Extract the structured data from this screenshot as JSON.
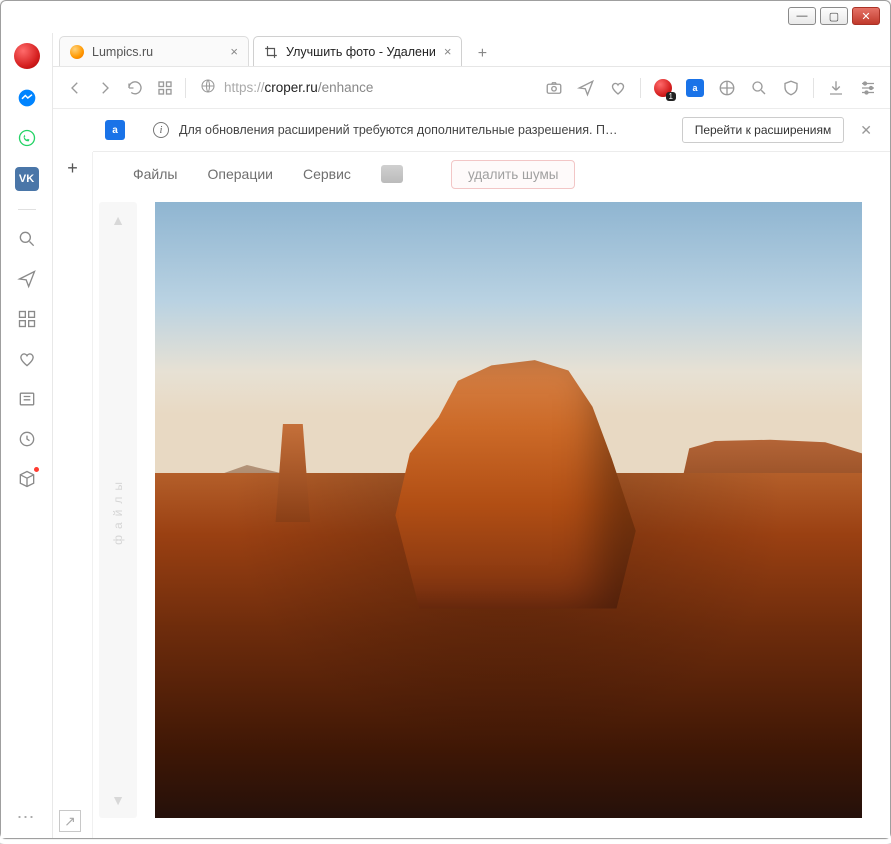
{
  "window": {
    "controls": {
      "minimize": "—",
      "maximize": "▢",
      "close": "✕"
    }
  },
  "tabs": [
    {
      "title": "Lumpics.ru",
      "active": false
    },
    {
      "title": "Улучшить фото - Удалени",
      "active": true
    }
  ],
  "newtab_label": "+",
  "addressbar": {
    "protocol": "https://",
    "host": "croper.ru",
    "path": "/enhance"
  },
  "nav_badge": "1",
  "ext_notice": {
    "icon_letter": "a",
    "message": "Для обновления расширений требуются дополнительные разрешения. Перейдите в ме…",
    "button": "Перейти к расширениям",
    "close": "✕"
  },
  "inner_left": {
    "plus": "+"
  },
  "app_menu": {
    "files": "Файлы",
    "operations": "Операции",
    "service": "Сервис"
  },
  "action_button": "удалить шумы",
  "files_rail": {
    "up": "▲",
    "label": "файлы",
    "down": "▼"
  },
  "corner_link_glyph": "↗"
}
